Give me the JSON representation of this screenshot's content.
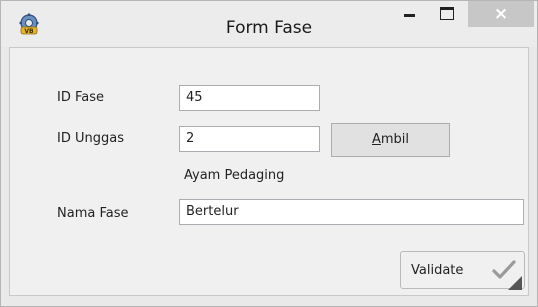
{
  "window": {
    "title": "Form Fase",
    "minimize_icon": "minimize-icon",
    "maximize_icon": "maximize-icon",
    "close_symbol": "×",
    "app_icon": "app-gear-icon"
  },
  "form": {
    "id_fase": {
      "label": "ID Fase",
      "value": "45"
    },
    "id_unggas": {
      "label": "ID Unggas",
      "value": "2"
    },
    "unggas_name": "Ayam Pedaging",
    "nama_fase": {
      "label": "Nama Fase",
      "value": "Bertelur"
    }
  },
  "buttons": {
    "ambil_mnemonic": "A",
    "ambil_rest": "mbil",
    "validate_label": "Validate",
    "validate_icon": "checkmark-icon"
  },
  "colors": {
    "close_button": "#c7c7c7",
    "window_bg": "#f0f0f0"
  }
}
